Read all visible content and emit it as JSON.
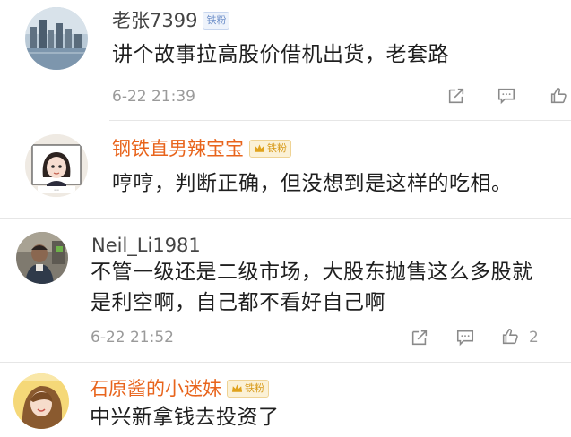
{
  "comments": [
    {
      "username": "老张7399",
      "badge": "铁粉",
      "text": "讲个故事拉高股价借机出货，老套路",
      "time": "6-22 21:39",
      "likes": ""
    },
    {
      "username": "钢铁直男辣宝宝",
      "badge": "铁粉",
      "text": "哼哼，判断正确，但没想到是这样的吃相。"
    },
    {
      "username": "Neil_Li1981",
      "text_line1": "不管一级还是二级市场，大股东抛售这么多股就",
      "text_line2": "是利空啊，自己都不看好自己啊",
      "time": "6-22 21:52",
      "likes": "2"
    },
    {
      "username": "石原酱的小迷妹",
      "badge": "铁粉",
      "text": "中兴新拿钱去投资了"
    }
  ],
  "colors": {
    "vip_name": "#e8641c",
    "normal_name": "#444444",
    "muted": "#9a9a9a",
    "badge_blue": "#6d8fc9",
    "badge_gold": "#d79a1a"
  },
  "icons": [
    "share-icon",
    "comment-icon",
    "like-icon",
    "crown-icon"
  ]
}
